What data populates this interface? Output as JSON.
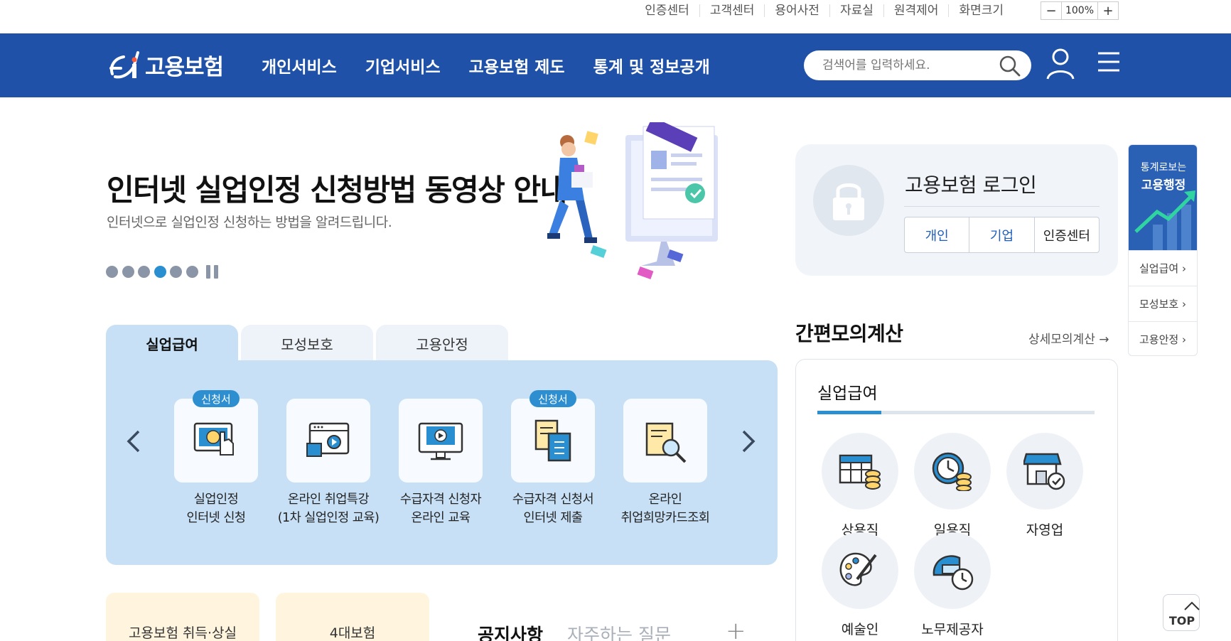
{
  "utility": {
    "links": [
      "인증센터",
      "고객센터",
      "용어사전",
      "자료실",
      "원격제어",
      "화면크기"
    ],
    "zoom_minus": "−",
    "zoom_value": "100%",
    "zoom_plus": "+"
  },
  "header": {
    "logo_text": "고용보험",
    "nav": [
      "개인서비스",
      "기업서비스",
      "고용보험 제도",
      "통계 및 정보공개"
    ],
    "search_placeholder": "검색어를 입력하세요.",
    "brand_color": "#1f51a8"
  },
  "banner": {
    "title": "인터넷 실업인정 신청방법 동영상 안내",
    "subtitle": "인터넷으로 실업인정 신청하는 방법을 알려드립니다.",
    "slide_count": 6,
    "active_slide": 4
  },
  "login": {
    "title": "고용보험 로그인",
    "buttons": [
      "개인",
      "기업",
      "인증센터"
    ]
  },
  "side": {
    "title_small": "통계로보는",
    "title_big": "고용행정",
    "items": [
      "실업급여",
      "모성보호",
      "고용안정"
    ]
  },
  "tabs": [
    "실업급여",
    "모성보호",
    "고용안정"
  ],
  "services": [
    {
      "badge": "신청서",
      "line1": "실업인정",
      "line2": "인터넷 신청"
    },
    {
      "badge": "",
      "line1": "온라인 취업특강",
      "line2": "(1차 실업인정 교육)"
    },
    {
      "badge": "",
      "line1": "수급자격 신청자",
      "line2": "온라인 교육"
    },
    {
      "badge": "신청서",
      "line1": "수급자격 신청서",
      "line2": "인터넷 제출"
    },
    {
      "badge": "",
      "line1": "온라인",
      "line2": "취업희망카드조회"
    }
  ],
  "calc": {
    "title": "간편모의계산",
    "detail_link": "상세모의계산",
    "sub_title": "실업급여",
    "items": [
      "상용직",
      "일용직",
      "자영업",
      "예술인",
      "노무제공자"
    ]
  },
  "bottom": {
    "card1": "고용보험 취득·상실",
    "card2": "4대보험",
    "notice_tab1": "공지사항",
    "notice_tab2": "자주하는 질문",
    "plus": "+"
  },
  "top_button": "TOP"
}
